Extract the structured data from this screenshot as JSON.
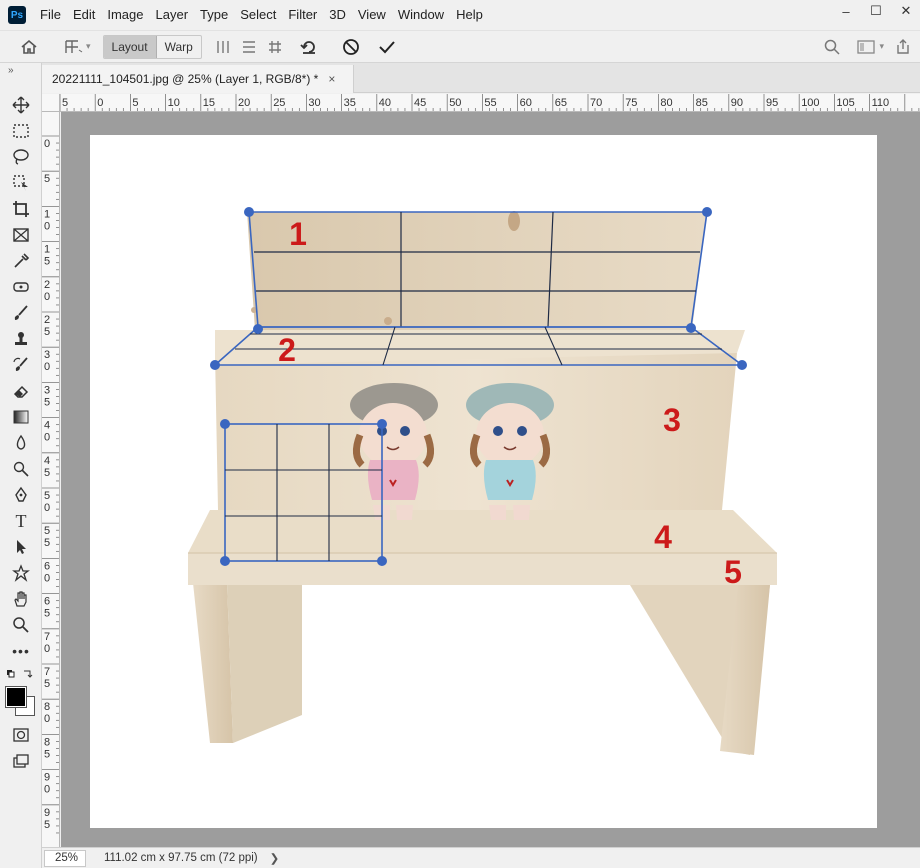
{
  "menu": [
    "File",
    "Edit",
    "Image",
    "Layer",
    "Type",
    "Select",
    "Filter",
    "3D",
    "View",
    "Window",
    "Help"
  ],
  "options": {
    "layout_label": "Layout",
    "warp_label": "Warp"
  },
  "document_tab": {
    "title": "20221111_104501.jpg @ 25% (Layer 1, RGB/8*) *",
    "close": "×"
  },
  "ruler_h_labels": [
    "5",
    "0",
    "5",
    "10",
    "15",
    "20",
    "25",
    "30",
    "35",
    "40",
    "45",
    "50",
    "55",
    "60",
    "65",
    "70",
    "75",
    "80",
    "85",
    "90",
    "95",
    "100",
    "105",
    "110"
  ],
  "ruler_v_labels": [
    "0",
    "5",
    "1\n0",
    "1\n5",
    "2\n0",
    "2\n5",
    "3\n0",
    "3\n5",
    "4\n0",
    "4\n5",
    "5\n0",
    "5\n5",
    "6\n0",
    "6\n5",
    "7\n0",
    "7\n5",
    "8\n0",
    "8\n5",
    "9\n0",
    "9\n5"
  ],
  "plane_labels": [
    "1",
    "2",
    "3",
    "4",
    "5"
  ],
  "status": {
    "zoom": "25%",
    "dimensions": "111.02 cm x 97.75 cm (72 ppi)",
    "arrow": "❯"
  },
  "colors": {
    "accent": "#3a66c0",
    "label_red": "#cc1a1a",
    "wood": "#e9ddc9"
  }
}
